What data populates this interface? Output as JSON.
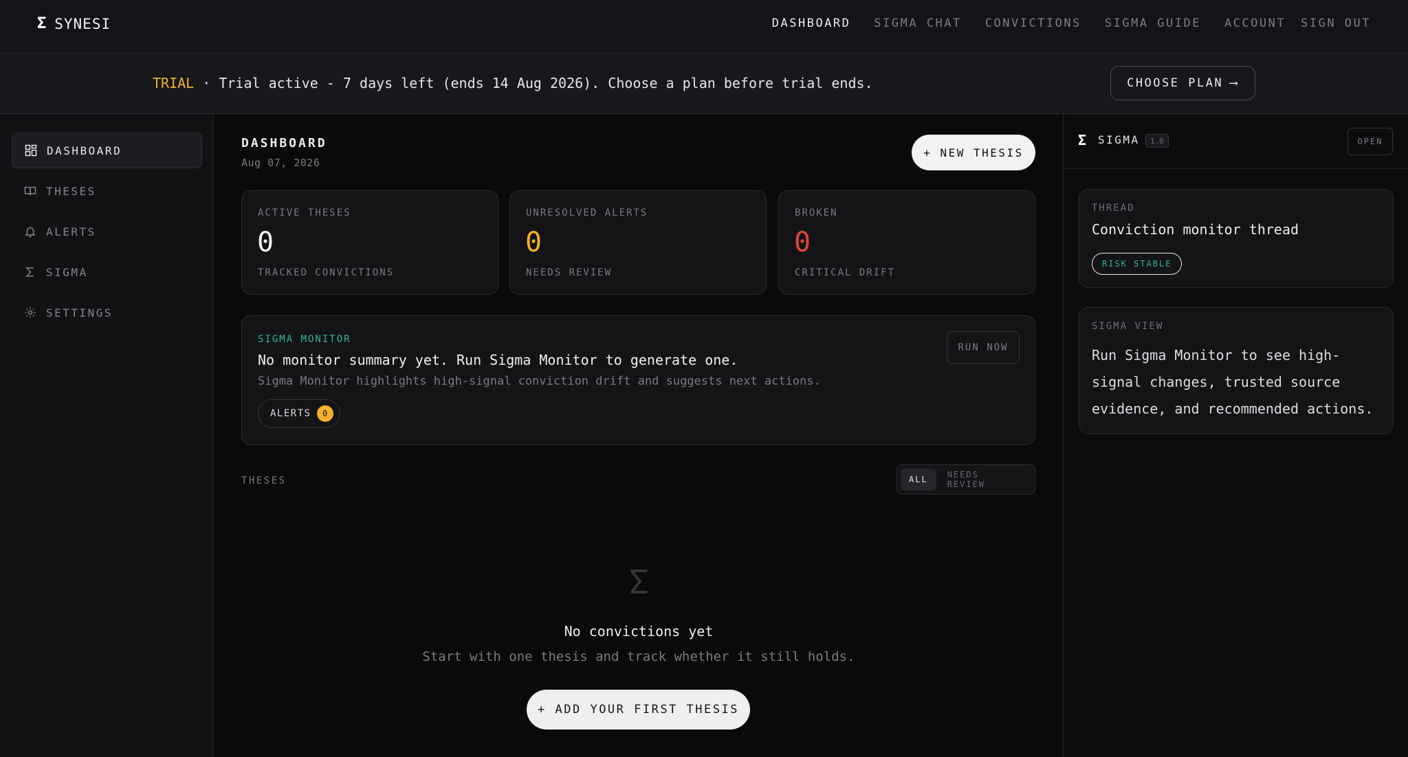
{
  "brand": {
    "mark": "Σ",
    "name": "SYNESI"
  },
  "nav": {
    "items": [
      "DASHBOARD",
      "SIGMA CHAT",
      "CONVICTIONS",
      "SIGMA GUIDE",
      "ACCOUNT"
    ],
    "signout": "SIGN OUT",
    "active": "DASHBOARD"
  },
  "banner": {
    "tag": "TRIAL",
    "sep": " · ",
    "message": "Trial active - 7 days left (ends 14 Aug 2026). Choose a plan before trial ends.",
    "cta": "CHOOSE PLAN",
    "cta_arrow": "⟶"
  },
  "sidebar": {
    "items": [
      {
        "label": "DASHBOARD",
        "icon": "grid-icon"
      },
      {
        "label": "THESES",
        "icon": "book-icon"
      },
      {
        "label": "ALERTS",
        "icon": "bell-icon"
      },
      {
        "label": "SIGMA",
        "icon": "sigma-icon"
      },
      {
        "label": "SETTINGS",
        "icon": "gear-icon"
      }
    ]
  },
  "main": {
    "title": "DASHBOARD",
    "date": "Aug 07, 2026",
    "new_thesis": "+ NEW THESIS",
    "stats": [
      {
        "label": "ACTIVE THESES",
        "value": "0",
        "sub": "TRACKED CONVICTIONS",
        "color": "#f4f4f6"
      },
      {
        "label": "UNRESOLVED ALERTS",
        "value": "0",
        "sub": "NEEDS REVIEW",
        "color": "#f2b12b"
      },
      {
        "label": "BROKEN",
        "value": "0",
        "sub": "CRITICAL DRIFT",
        "color": "#e5433a"
      }
    ],
    "monitor": {
      "kicker": "SIGMA MONITOR",
      "head": "No monitor summary yet. Run Sigma Monitor to generate one.",
      "desc": "Sigma Monitor highlights high-signal conviction drift and suggests next actions.",
      "alerts_label": "ALERTS",
      "alerts_count": "0",
      "run": "RUN NOW"
    },
    "theses": {
      "label": "THESES",
      "filters": [
        "ALL",
        "NEEDS REVIEW"
      ],
      "active_filter": "ALL",
      "empty_icon": "Σ",
      "empty_title": "No convictions yet",
      "empty_sub": "Start with one thesis and track whether it still holds.",
      "add_first": "+ ADD YOUR FIRST THESIS"
    }
  },
  "sigma_panel": {
    "mark": "Σ",
    "title": "SIGMA",
    "version": "1.0",
    "open": "OPEN",
    "thread": {
      "kicker": "THREAD",
      "title": "Conviction monitor thread",
      "badge": "RISK STABLE"
    },
    "view": {
      "kicker": "SIGMA VIEW",
      "text": "Run Sigma Monitor to see high-signal changes, trusted source evidence, and recommended actions."
    }
  },
  "colors": {
    "accent": "#2bb89a",
    "warning": "#f2b12b",
    "danger": "#e5433a",
    "background": "#0a0a0b"
  }
}
